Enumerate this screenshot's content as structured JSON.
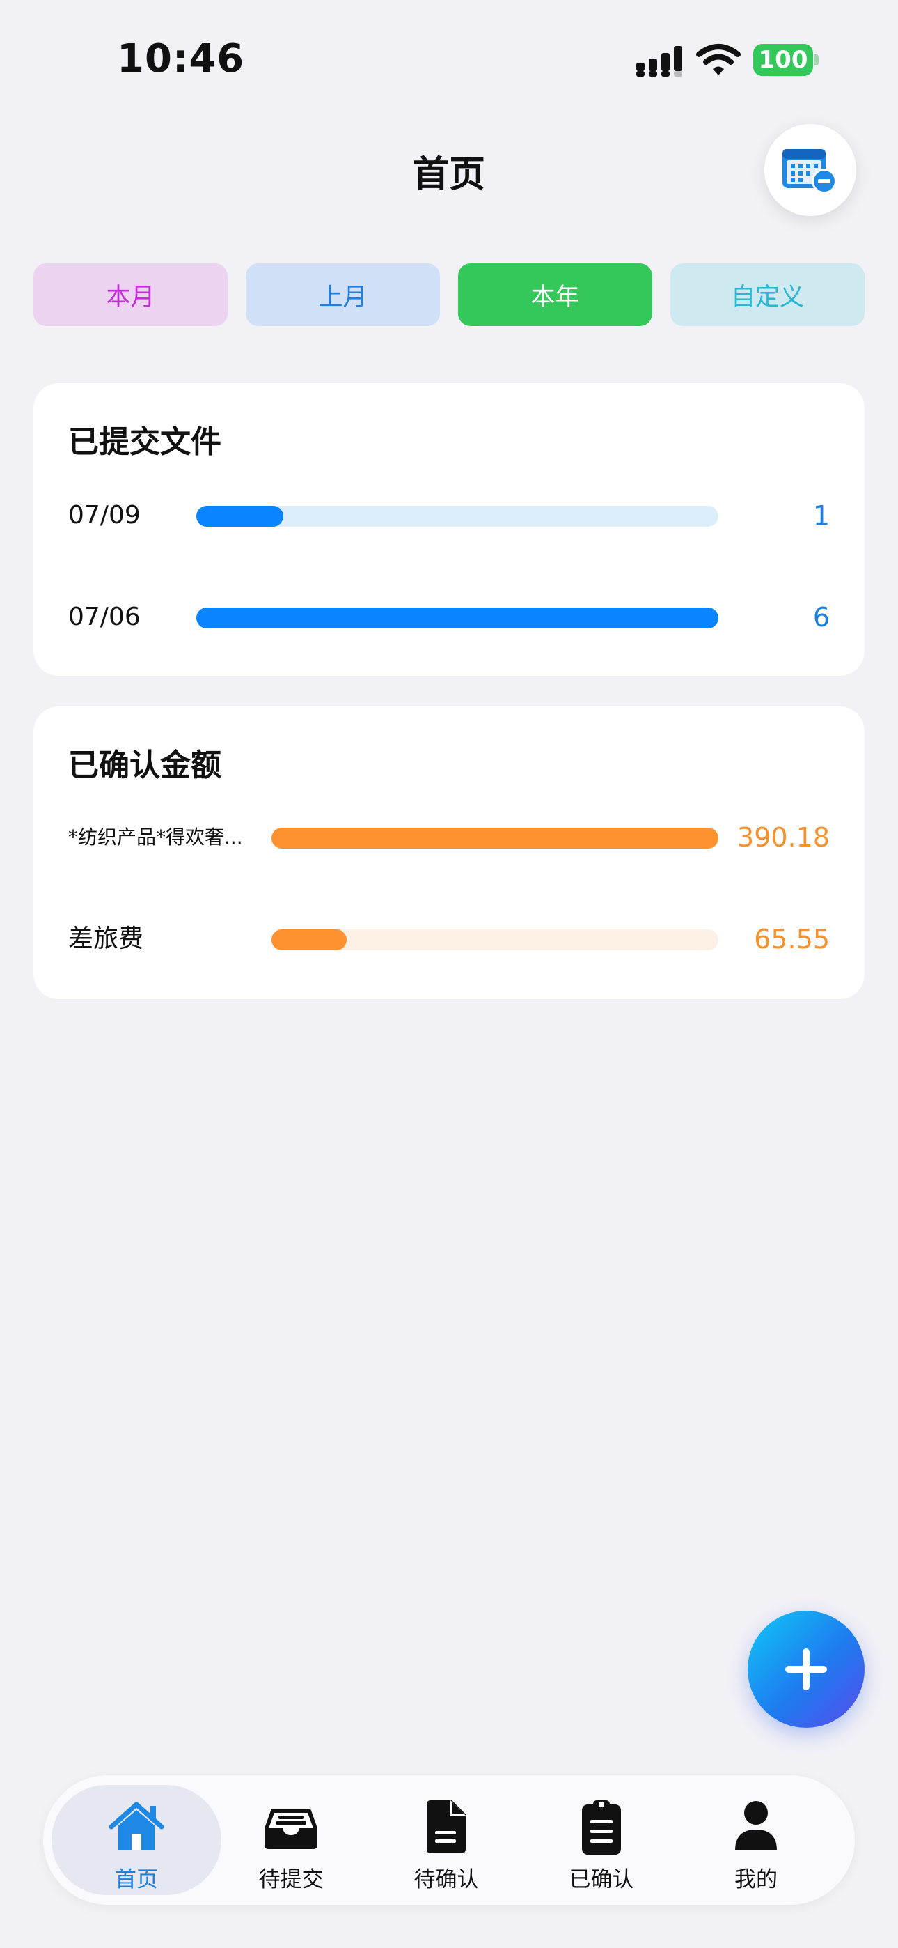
{
  "status_bar": {
    "time": "10:46",
    "battery": "100"
  },
  "header": {
    "title": "首页",
    "calendar_icon": "calendar-minus-icon"
  },
  "period_tabs": [
    {
      "label": "本月",
      "selected": false
    },
    {
      "label": "上月",
      "selected": false
    },
    {
      "label": "本年",
      "selected": true
    },
    {
      "label": "自定义",
      "selected": false
    }
  ],
  "submitted_files": {
    "title": "已提交文件",
    "rows": [
      {
        "label": "07/09",
        "value": "1",
        "fraction": 0.1667
      },
      {
        "label": "07/06",
        "value": "6",
        "fraction": 1.0
      }
    ]
  },
  "confirmed_amounts": {
    "title": "已确认金额",
    "rows": [
      {
        "label": "*纺织产品*得欢奢...",
        "value": "390.18",
        "fraction": 1.0
      },
      {
        "label": "差旅费",
        "value": "65.55",
        "fraction": 0.168
      }
    ]
  },
  "fab": {
    "icon": "plus-icon"
  },
  "tab_bar": {
    "items": [
      {
        "label": "首页",
        "icon": "home-icon",
        "active": true
      },
      {
        "label": "待提交",
        "icon": "inbox-icon",
        "active": false
      },
      {
        "label": "待确认",
        "icon": "document-icon",
        "active": false
      },
      {
        "label": "已确认",
        "icon": "clipboard-icon",
        "active": false
      },
      {
        "label": "我的",
        "icon": "person-icon",
        "active": false
      }
    ]
  },
  "colors": {
    "accent_blue": "#0A84FF",
    "accent_orange": "#FF9230",
    "selected_green": "#34C759"
  }
}
